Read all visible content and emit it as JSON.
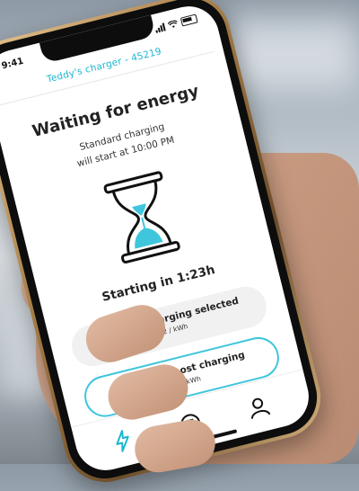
{
  "status_bar": {
    "time": "9:41"
  },
  "header": {
    "title": "Teddy's charger - 45219"
  },
  "main": {
    "title": "Waiting for energy",
    "subtitle_line1": "Standard charging",
    "subtitle_line2": "will start at 10:00 PM",
    "countdown": "Starting in 1:23h"
  },
  "buttons": {
    "standard": {
      "label": "Standard charging selected",
      "price": "$0.2 / kWh"
    },
    "boost": {
      "label": "Switch to boost charging",
      "price": "$0.5 / kWh"
    }
  },
  "tabs": [
    {
      "icon": "lightning-icon"
    },
    {
      "icon": "history-icon"
    },
    {
      "icon": "profile-icon"
    }
  ],
  "colors": {
    "accent": "#1ab6cf",
    "boost_border": "#3fc6dc",
    "hourglass_sand": "#3fc6dc"
  }
}
